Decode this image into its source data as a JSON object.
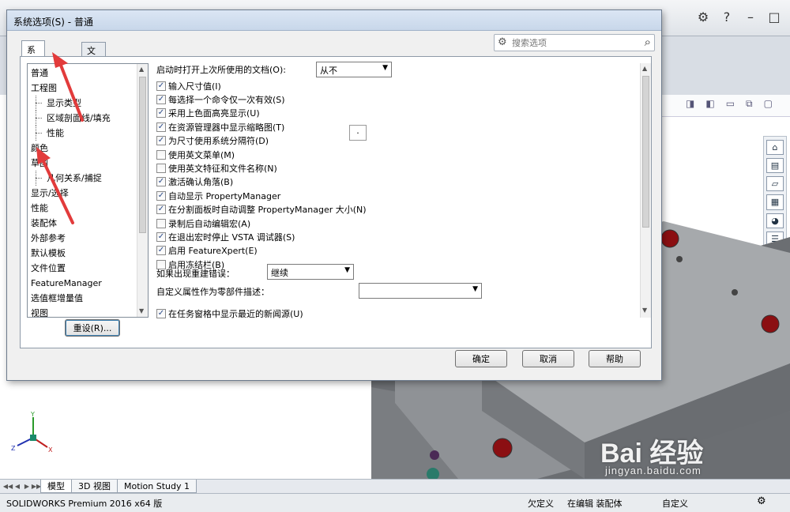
{
  "app": {
    "icons": [
      "gear-icon",
      "help-icon",
      "minimize-icon",
      "maximize-icon"
    ],
    "status": {
      "product": "SOLIDWORKS Premium 2016 x64 版",
      "units": "欠定义",
      "mode": "在编辑 装配体",
      "custom": "自定义"
    },
    "bottom_tabs": [
      "模型",
      "3D 视图",
      "Motion Study 1"
    ],
    "watermark": {
      "logo": "Bai 经验",
      "url": "jingyan.baidu.com"
    }
  },
  "dialog": {
    "title": "系统选项(S) - 普通",
    "tabs": [
      "系统选项(S)",
      "文档属性(D)"
    ],
    "search_placeholder": "搜索选项",
    "reset_label": "重设(R)...",
    "buttons": {
      "ok": "确定",
      "cancel": "取消",
      "help": "帮助"
    }
  },
  "tree": [
    {
      "label": "普通",
      "child": false
    },
    {
      "label": "工程图",
      "child": false
    },
    {
      "label": "显示类型",
      "child": true
    },
    {
      "label": "区域剖面线/填充",
      "child": true
    },
    {
      "label": "性能",
      "child": true
    },
    {
      "label": "颜色",
      "child": false
    },
    {
      "label": "草图",
      "child": false
    },
    {
      "label": "几何关系/捕捉",
      "child": true
    },
    {
      "label": "显示/选择",
      "child": false
    },
    {
      "label": "性能",
      "child": false
    },
    {
      "label": "装配体",
      "child": false
    },
    {
      "label": "外部参考",
      "child": false
    },
    {
      "label": "默认模板",
      "child": false
    },
    {
      "label": "文件位置",
      "child": false
    },
    {
      "label": "FeatureManager",
      "child": false
    },
    {
      "label": "选值框增量值",
      "child": false
    },
    {
      "label": "视图",
      "child": false
    }
  ],
  "options": {
    "open_last_label": "启动时打开上次所使用的文档(O):",
    "open_last_value": "从不",
    "checkboxes": [
      {
        "label": "输入尺寸值(I)",
        "checked": true
      },
      {
        "label": "每选择一个命令仅一次有效(S)",
        "checked": true
      },
      {
        "label": "采用上色面高亮显示(U)",
        "checked": true
      },
      {
        "label": "在资源管理器中显示缩略图(T)",
        "checked": true
      },
      {
        "label": "为尺寸使用系统分隔符(D)",
        "checked": true
      },
      {
        "label": "使用英文菜单(M)",
        "checked": false
      },
      {
        "label": "使用英文特征和文件名称(N)",
        "checked": false
      },
      {
        "label": "激活确认角落(B)",
        "checked": true
      },
      {
        "label": "自动显示 PropertyManager",
        "checked": true
      },
      {
        "label": "在分割面板时自动调整 PropertyManager 大小(N)",
        "checked": true
      },
      {
        "label": "录制后自动编辑宏(A)",
        "checked": false
      },
      {
        "label": "在退出宏时停止 VSTA 调试器(S)",
        "checked": true
      },
      {
        "label": "启用 FeatureXpert(E)",
        "checked": true
      },
      {
        "label": "启用冻结栏(B)",
        "checked": false
      }
    ],
    "separator_value": ".",
    "rebuild_error_label": "如果出现重建错误：",
    "rebuild_error_value": "继续",
    "custom_prop_label": "自定义属性作为零部件描述：",
    "custom_prop_value": "",
    "last_partial": {
      "label": "在任务窗格中显示最近的新闻源(U)",
      "checked": true
    }
  },
  "task_pane_icons": [
    "home-icon",
    "parts-icon",
    "folder-icon",
    "view-palette-icon",
    "appearance-icon",
    "properties-icon",
    "forum-icon"
  ]
}
